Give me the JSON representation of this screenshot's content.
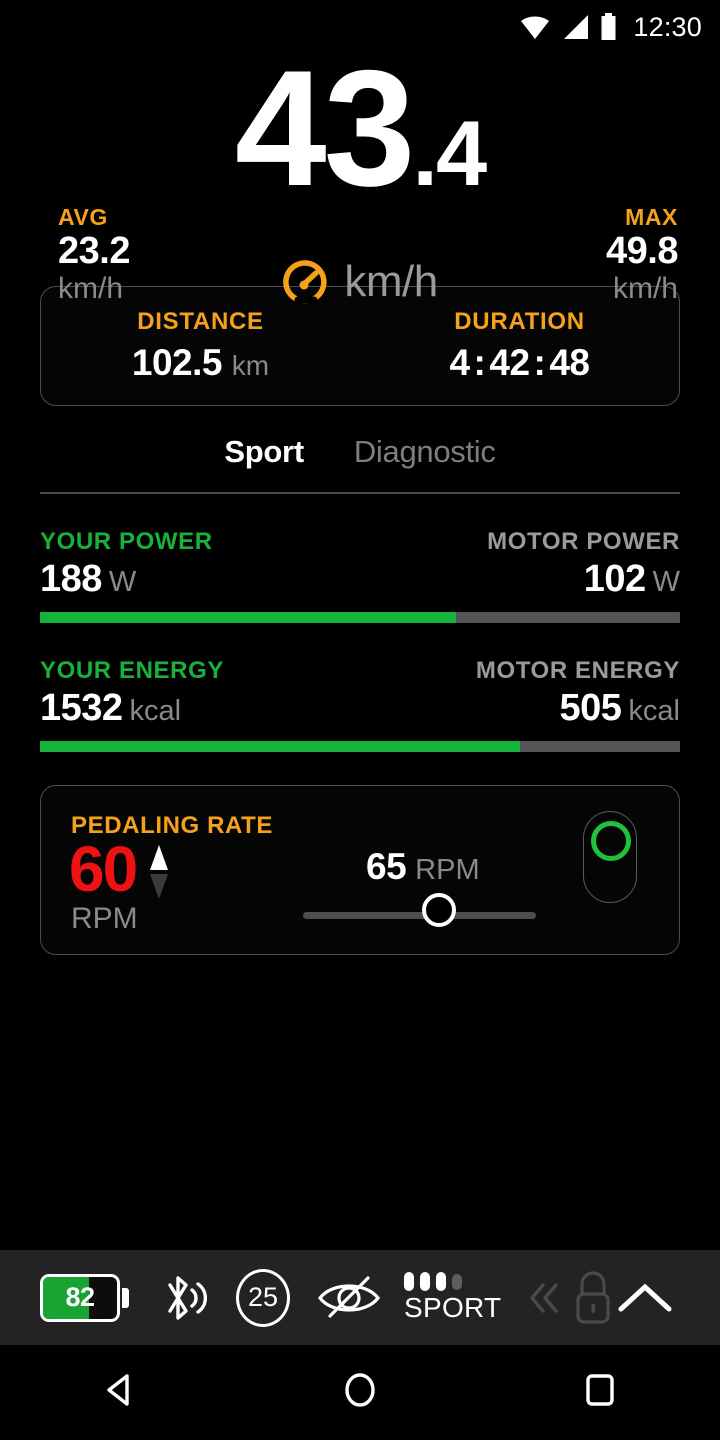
{
  "status_bar": {
    "clock": "12:30",
    "icons": [
      "wifi-icon",
      "cellular-signal-icon",
      "battery-icon"
    ]
  },
  "speed": {
    "integer": "43",
    "decimal": ".4",
    "unit": "km/h",
    "gauge_icon": "speedometer-icon",
    "avg": {
      "label": "AVG",
      "value": "23.2",
      "unit": "km/h"
    },
    "max": {
      "label": "MAX",
      "value": "49.8",
      "unit": "km/h"
    }
  },
  "trip": {
    "distance": {
      "label": "DISTANCE",
      "value": "102.5",
      "unit": "km"
    },
    "duration": {
      "label": "DURATION",
      "hours": "4",
      "minutes": "42",
      "seconds": "48",
      "separator": ":"
    }
  },
  "tabs": [
    {
      "label": "Sport",
      "active": true
    },
    {
      "label": "Diagnostic",
      "active": false
    }
  ],
  "metrics": [
    {
      "left_label": "YOUR POWER",
      "left_value": "188",
      "left_unit": "W",
      "right_label": "MOTOR POWER",
      "right_value": "102",
      "right_unit": "W",
      "fill_percent": 65
    },
    {
      "left_label": "YOUR ENERGY",
      "left_value": "1532",
      "left_unit": "kcal",
      "right_label": "MOTOR ENERGY",
      "right_value": "505",
      "right_unit": "kcal",
      "fill_percent": 75
    }
  ],
  "pedaling": {
    "label": "PEDALING RATE",
    "current": "60",
    "current_unit": "RPM",
    "target": "65",
    "target_unit": "RPM",
    "slider_percent": 60,
    "trend_up_icon": "arrow-up-icon",
    "trend_down_icon": "arrow-down-icon",
    "led_icon": "led-indicator-icon"
  },
  "toolbar": {
    "battery_percent": "82",
    "battery_fill": 62,
    "bluetooth_icon": "bluetooth-audio-icon",
    "speed_limit": "25",
    "light_icon": "light-off-icon",
    "assist_label": "SPORT",
    "assist_level": 3,
    "assist_levels_total": 4,
    "walk_icon": "walk-assist-icon",
    "lock_icon": "lock-icon",
    "expand_icon": "chevron-up-icon"
  },
  "navbar": {
    "back": "back-triangle-icon",
    "home": "home-circle-icon",
    "recents": "recents-square-icon"
  },
  "colors": {
    "accent_orange": "#f5a11b",
    "accent_green": "#17b13b",
    "alert_red": "#ee1212",
    "muted": "#8a8a8a",
    "background": "#000000",
    "toolbar_bg": "#232323"
  }
}
